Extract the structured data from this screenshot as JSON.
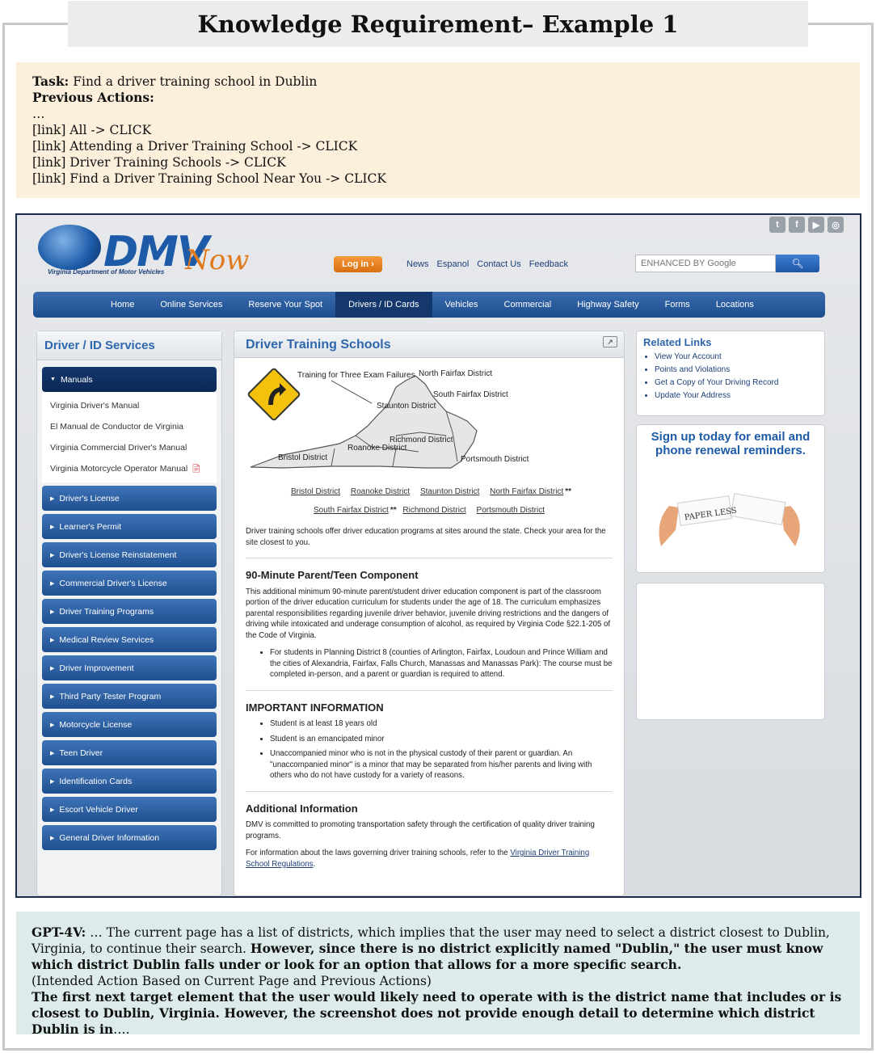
{
  "header": {
    "title": "Knowledge Requirement– Example 1"
  },
  "task": {
    "task_label": "Task:",
    "task_text": "Find a driver training school in Dublin",
    "prev_label": "Previous Actions:",
    "ellipsis": "…",
    "actions": [
      "[link]  All -> CLICK",
      "[link]  Attending a Driver Training School -> CLICK",
      "[link]  Driver Training Schools -> CLICK",
      "[link]  Find a Driver Training School Near You -> CLICK"
    ]
  },
  "site": {
    "logo_text": "DMV",
    "logo_now": "Now",
    "logo_sub": "Virginia Department of Motor Vehicles",
    "login_label": "Log in ›",
    "top_links": [
      "News",
      "Espanol",
      "Contact Us",
      "Feedback"
    ],
    "search_placeholder": "ENHANCED BY Google",
    "nav": [
      "Home",
      "Online Services",
      "Reserve Your Spot",
      "Drivers / ID Cards",
      "Vehicles",
      "Commercial",
      "Highway Safety",
      "Forms",
      "Locations"
    ],
    "nav_active": "Drivers / ID Cards",
    "sidebar": {
      "title": "Driver / ID Services",
      "manuals_label": "Manuals",
      "manuals": [
        "Virginia Driver's Manual",
        "El Manual de Conductor de Virginia",
        "Virginia Commercial Driver's Manual",
        "Virginia Motorcycle Operator Manual"
      ],
      "items": [
        "Driver's License",
        "Learner's Permit",
        "Driver's License Reinstatement",
        "Commercial Driver's License",
        "Driver Training Programs",
        "Medical Review Services",
        "Driver Improvement",
        "Third Party Tester Program",
        "Motorcycle License",
        "Teen Driver",
        "Identification Cards",
        "Escort Vehicle Driver",
        "General Driver Information"
      ]
    },
    "main": {
      "title": "Driver Training Schools",
      "map_labels": {
        "training": "Training for Three Exam Failures",
        "north_fairfax": "North Fairfax District",
        "south_fairfax": "South Fairfax District",
        "staunton": "Staunton District",
        "richmond": "Richmond District",
        "roanoke": "Roanoke District",
        "bristol": "Bristol District",
        "portsmouth": "Portsmouth District"
      },
      "district_links_row1": [
        "Bristol District",
        "Roanoke District",
        "Staunton District",
        "North Fairfax District"
      ],
      "district_links_row2": [
        "South Fairfax District",
        "Richmond District",
        "Portsmouth District"
      ],
      "star": "**",
      "intro": "Driver training schools offer driver education programs at sites around the state. Check your area for the site closest to you.",
      "section1_title": "90-Minute Parent/Teen Component",
      "section1_text": "This additional minimum 90-minute parent/student driver education component is part of the classroom portion of the driver education curriculum for students under the age of 18. The curriculum emphasizes parental responsibilities regarding juvenile driver behavior, juvenile driving restrictions and the dangers of driving while intoxicated and underage consumption of alcohol, as required by Virginia Code §22.1-205 of the Code of Virginia.",
      "section1_bullet": "For students in Planning District 8 (counties of Arlington, Fairfax, Loudoun and Prince William and the cities of Alexandria, Fairfax, Falls Church, Manassas and Manassas Park): The course must be completed in-person, and a parent or guardian is required to attend.",
      "section2_title": "IMPORTANT INFORMATION",
      "section2_bullets": [
        "Student is at least 18 years old",
        "Student is an emancipated minor",
        "Unaccompanied minor who is not in the physical custody of their parent or guardian. An \"unaccompanied minor\" is a minor that may be separated from his/her parents and living with others who do not have custody for a variety of reasons."
      ],
      "section3_title": "Additional Information",
      "section3_text": "DMV is committed to promoting transportation safety through the certification of quality driver training programs.",
      "section3_text2_prefix": "For information about the laws governing driver training schools, refer to the ",
      "section3_link": "Virginia Driver Training School Regulations",
      "section3_text2_suffix": "."
    },
    "related": {
      "title": "Related Links",
      "links": [
        "View Your Account",
        "Points and Violations",
        "Get a Copy of Your Driving Record",
        "Update Your Address"
      ]
    },
    "signup_text": "Sign up today for email and phone renewal reminders.",
    "paper_text": "PAPER LESS"
  },
  "gpt": {
    "label": "GPT-4V:",
    "p1": " … The current page has a list of districts, which implies that the user may need to select a district closest to Dublin, Virginia, to continue their search. ",
    "p1_bold": "However, since there is no district explicitly named \"Dublin,\" the user must know which district Dublin falls under or look for an option that allows for a more specific search.",
    "p2": "(Intended Action Based on Current Page and Previous Actions)",
    "p3_bold": "The first next target element that the user would likely need to operate with is the district name that includes or is closest to Dublin, Virginia. However, the screenshot does not provide enough detail to determine which district Dublin is in",
    "p3_end": "…."
  }
}
